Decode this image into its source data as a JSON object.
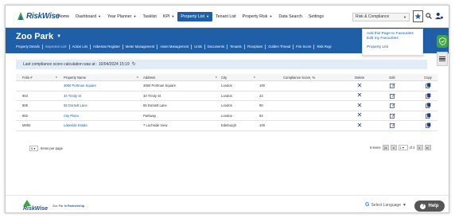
{
  "brand": {
    "logo_text": "RiskWise"
  },
  "nav": {
    "items": [
      {
        "label": "Home",
        "caret": false,
        "active": false
      },
      {
        "label": "Dashboard",
        "caret": true,
        "active": false
      },
      {
        "label": "Year Planner",
        "caret": true,
        "active": false
      },
      {
        "label": "Tasklist",
        "caret": false,
        "active": false
      },
      {
        "label": "KPI",
        "caret": true,
        "active": false
      },
      {
        "label": "Property List",
        "caret": true,
        "active": true
      },
      {
        "label": "Tenant List",
        "caret": false,
        "active": false
      },
      {
        "label": "Property Risk",
        "caret": true,
        "active": false
      },
      {
        "label": "Data Search",
        "caret": false,
        "active": false
      },
      {
        "label": "Settings",
        "caret": false,
        "active": false
      }
    ],
    "module_select": "Risk & Compliance"
  },
  "favourites_menu": {
    "items": [
      "Add this Page to Favourites",
      "Edit my Favourites"
    ],
    "saved": [
      "Property List"
    ]
  },
  "site": {
    "title": "Zoo Park",
    "subnav": [
      {
        "label": "Property Details",
        "dim": false
      },
      {
        "label": "Inspection List",
        "dim": true
      },
      {
        "label": "Action List",
        "dim": false
      },
      {
        "label": "Asbestos Register",
        "dim": false
      },
      {
        "label": "Meter Management",
        "dim": false
      },
      {
        "label": "Asset Management",
        "dim": false
      },
      {
        "label": "Units",
        "dim": false
      },
      {
        "label": "Documents",
        "dim": false
      },
      {
        "label": "Tenants",
        "dim": false
      },
      {
        "label": "Floorplans",
        "dim": false
      },
      {
        "label": "Golden Thread",
        "dim": false
      },
      {
        "label": "Fire Score",
        "dim": false
      },
      {
        "label": "Risk Regi",
        "dim": false
      }
    ]
  },
  "info": {
    "text": "Last compliance score calculation was at : 10/04/2024 15:19"
  },
  "table": {
    "headers": {
      "folio": "Folio #",
      "name": "Property Name",
      "address": "Address",
      "city": "City",
      "score": "Compliance Score, %",
      "delete": "Delete",
      "edit": "Edit",
      "copy": "Copy"
    },
    "rows": [
      {
        "folio": "",
        "name": "3060 Portman Square",
        "address": "3060 Portman Square",
        "city": "London",
        "score": "100"
      },
      {
        "folio": "904",
        "name": "34 Trinity St",
        "address": "34 Trinity St",
        "city": "London",
        "score": "23"
      },
      {
        "folio": "806",
        "name": "55 Dorsett Lane",
        "address": "55 Dorsett Lane",
        "city": "London",
        "score": "90"
      },
      {
        "folio": "862",
        "name": "City Plaza",
        "address": "Parkway",
        "city": "London",
        "score": "94"
      },
      {
        "folio": "M002",
        "name": "Lakeside Estate",
        "address": "7 Lochside View",
        "city": "Edinburgh",
        "score": "100"
      }
    ]
  },
  "pagination": {
    "per_page": "5",
    "per_page_label": "Items per page",
    "items_count": "9 items",
    "page": "1",
    "of_pages": "of 2"
  },
  "footer": {
    "logo_text": "RiskWise",
    "partner_prefix": "Zoo Par ",
    "partner_name": "In Partnership",
    "language_label": "Select Language",
    "help_label": "Help"
  },
  "colors": {
    "brand_blue": "#1f5fa8",
    "highlight_red": "#d9232e",
    "shield_green": "#3ea745"
  }
}
